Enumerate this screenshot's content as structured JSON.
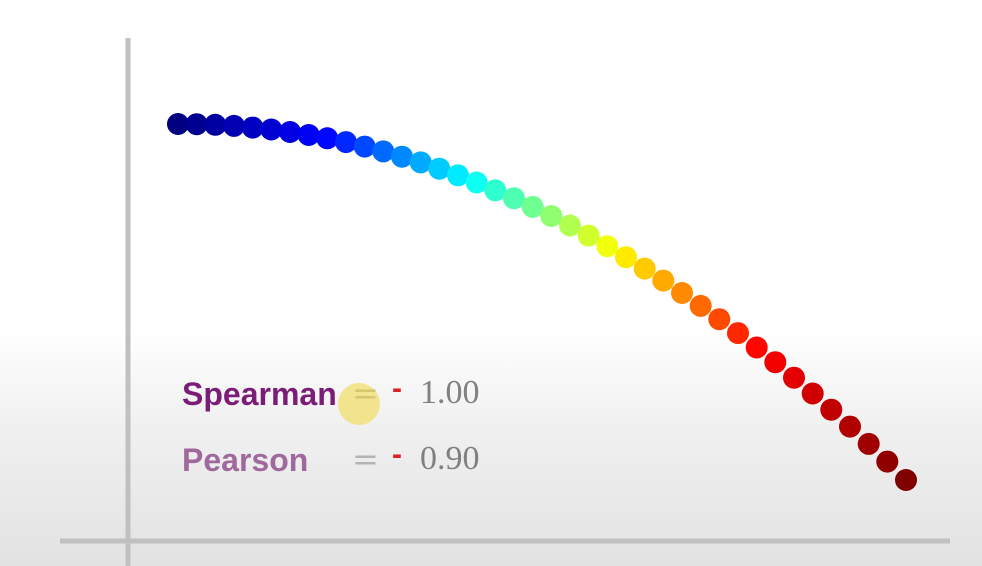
{
  "chart_data": {
    "type": "scatter",
    "title": "",
    "xlabel": "",
    "ylabel": "",
    "grid": false,
    "legend": "none",
    "x": [
      1,
      2,
      3,
      4,
      5,
      6,
      7,
      8,
      9,
      10,
      11,
      12,
      13,
      14,
      15,
      16,
      17,
      18,
      19,
      20,
      21,
      22,
      23,
      24,
      25,
      26,
      27,
      28,
      29,
      30,
      31,
      32,
      33,
      34,
      35,
      36,
      37,
      38,
      39,
      40
    ],
    "y": [
      1.0,
      0.999,
      0.996,
      0.991,
      0.983,
      0.974,
      0.962,
      0.948,
      0.932,
      0.914,
      0.893,
      0.87,
      0.845,
      0.818,
      0.788,
      0.757,
      0.723,
      0.686,
      0.648,
      0.607,
      0.564,
      0.519,
      0.471,
      0.421,
      0.369,
      0.315,
      0.258,
      0.199,
      0.138,
      0.075,
      0.009,
      -0.059,
      -0.129,
      -0.202,
      -0.277,
      -0.354,
      -0.434,
      -0.516,
      -0.6,
      -0.687
    ],
    "colormap": [
      "#000080",
      "#0000ff",
      "#00ffff",
      "#ffff00",
      "#ff0000",
      "#800000"
    ]
  },
  "stats": {
    "spearman": {
      "label": "Spearman",
      "equals": "=",
      "sign": "-",
      "value": "1.00",
      "color": "#7b1c77"
    },
    "pearson": {
      "label": "Pearson",
      "equals": "=",
      "sign": "-",
      "value": "0.90",
      "color": "#a0699d"
    }
  },
  "axis_color": "#c0c0c0"
}
